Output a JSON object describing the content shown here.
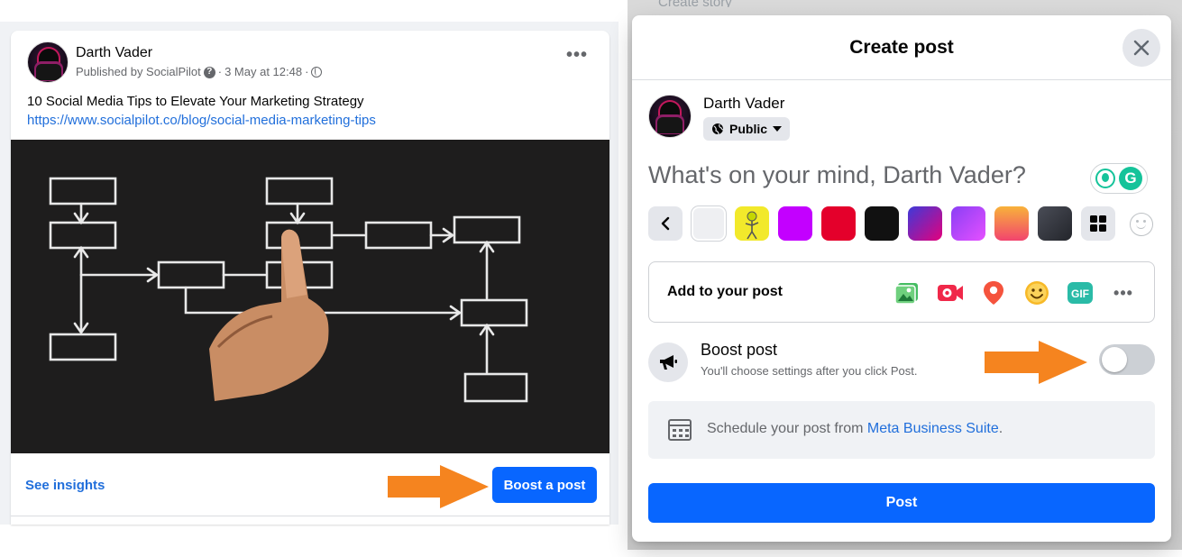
{
  "feed_post": {
    "author": "Darth Vader",
    "published_by": "Published by SocialPilot",
    "help_icon": "question-icon",
    "timestamp": "3 May at 12:48",
    "separator": "·",
    "audience_icon": "globe-icon",
    "menu_label": "•••",
    "text_line": "10 Social Media Tips to Elevate Your Marketing Strategy",
    "link": "https://www.socialpilot.co/blog/social-media-marketing-tips",
    "image_description_icon": "flowchart-image",
    "see_insights": "See insights",
    "boost_button": "Boost a post"
  },
  "create_post_modal": {
    "title": "Create post",
    "close_icon": "close-icon",
    "author": "Darth Vader",
    "audience": "Public",
    "composer_placeholder": "What's on your mind, Darth Vader?",
    "grammarly_letter": "G",
    "background_swatches": [
      "#eeeff2",
      "#f2e92b",
      "#c300ff",
      "#e4002b",
      "#111111",
      "gradient-blue-pink",
      "gradient-purple",
      "gradient-orange",
      "#2f3138",
      "grid-icon"
    ],
    "add_to_post_label": "Add to your post",
    "add_to_post_icons": [
      "photo-video-icon",
      "live-video-icon",
      "location-pin-icon",
      "feeling-emoji-icon",
      "gif-icon",
      "more-icon"
    ],
    "gif_label": "GIF",
    "more_label": "•••",
    "boost_title": "Boost post",
    "boost_subtitle": "You'll choose settings after you click Post.",
    "boost_toggle_on": false,
    "schedule_text": "Schedule your post from",
    "schedule_link": "Meta Business Suite",
    "schedule_suffix": ".",
    "post_button": "Post",
    "peek_text": "Create story"
  },
  "colors": {
    "brand_blue": "#0866ff",
    "link_blue": "#216fdb",
    "annotation_arrow": "#f5841f",
    "muted_text": "#65676b"
  }
}
